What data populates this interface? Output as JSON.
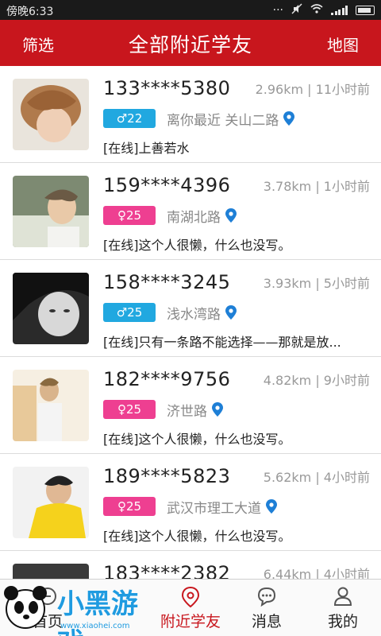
{
  "statusbar": {
    "time": "傍晚6:33"
  },
  "header": {
    "left": "筛选",
    "title": "全部附近学友",
    "right": "地图"
  },
  "colors": {
    "accent": "#c8161d",
    "male": "#21a8e0",
    "female": "#ee3f91",
    "pin": "#1e7fd6"
  },
  "items": [
    {
      "name": "133****5380",
      "meta": "2.96km | 11小时前",
      "gender": "male",
      "age": "♂22",
      "location": "离你最近  关山二路",
      "status": "[在线]上善若水"
    },
    {
      "name": "159****4396",
      "meta": "3.78km | 1小时前",
      "gender": "female",
      "age": "♀25",
      "location": "南湖北路",
      "status": "[在线]这个人很懒，什么也没写。"
    },
    {
      "name": "158****3245",
      "meta": "3.93km | 5小时前",
      "gender": "male",
      "age": "♂25",
      "location": "浅水湾路",
      "status": "[在线]只有一条路不能选择——那就是放..."
    },
    {
      "name": "182****9756",
      "meta": "4.82km | 9小时前",
      "gender": "female",
      "age": "♀25",
      "location": "济世路",
      "status": "[在线]这个人很懒，什么也没写。"
    },
    {
      "name": "189****5823",
      "meta": "5.62km | 4小时前",
      "gender": "female",
      "age": "♀25",
      "location": "武汉市理工大道",
      "status": "[在线]这个人很懒，什么也没写。"
    },
    {
      "name": "183****2382",
      "meta": "6.44km | 4小时前",
      "gender": "male",
      "age": "",
      "location": "",
      "status": ""
    }
  ],
  "tabs": [
    {
      "label": "首页",
      "icon": "home-icon"
    },
    {
      "label": "附近学友",
      "icon": "location-pin-icon"
    },
    {
      "label": "消息",
      "icon": "chat-bubble-icon"
    },
    {
      "label": "我的",
      "icon": "user-icon"
    }
  ],
  "watermark": {
    "text": "小黑游戏",
    "url": "www.xiaohei.com"
  }
}
